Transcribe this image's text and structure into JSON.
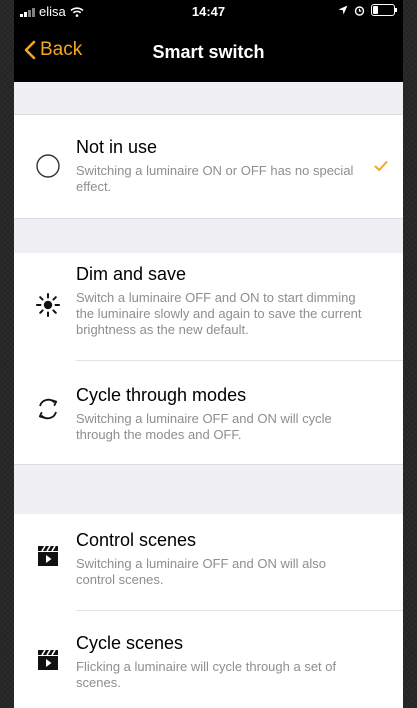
{
  "status_bar": {
    "carrier": "elisa",
    "time": "14:47"
  },
  "nav": {
    "back_label": "Back",
    "title": "Smart switch"
  },
  "options": [
    {
      "title": "Not in use",
      "description": "Switching a luminaire ON or OFF has no special effect.",
      "icon": "radio-circle-icon",
      "selected": true
    },
    {
      "title": "Dim and save",
      "description": "Switch a luminaire OFF and ON to start dimming the luminaire slowly and again to save the current brightness as the new default.",
      "icon": "brightness-icon",
      "selected": false
    },
    {
      "title": "Cycle through modes",
      "description": "Switching a luminaire OFF and ON will cycle through the modes and OFF.",
      "icon": "cycle-icon",
      "selected": false
    },
    {
      "title": "Control scenes",
      "description": "Switching a luminaire OFF and ON will also control scenes.",
      "icon": "clapperboard-icon",
      "selected": false
    },
    {
      "title": "Cycle scenes",
      "description": "Flicking a luminaire will cycle through a set of scenes.",
      "icon": "clapperboard-icon",
      "selected": false
    }
  ],
  "colors": {
    "accent": "#f5a623",
    "bar_background": "#000000",
    "section_background": "#efeff4",
    "secondary_text": "#8e8e93"
  }
}
